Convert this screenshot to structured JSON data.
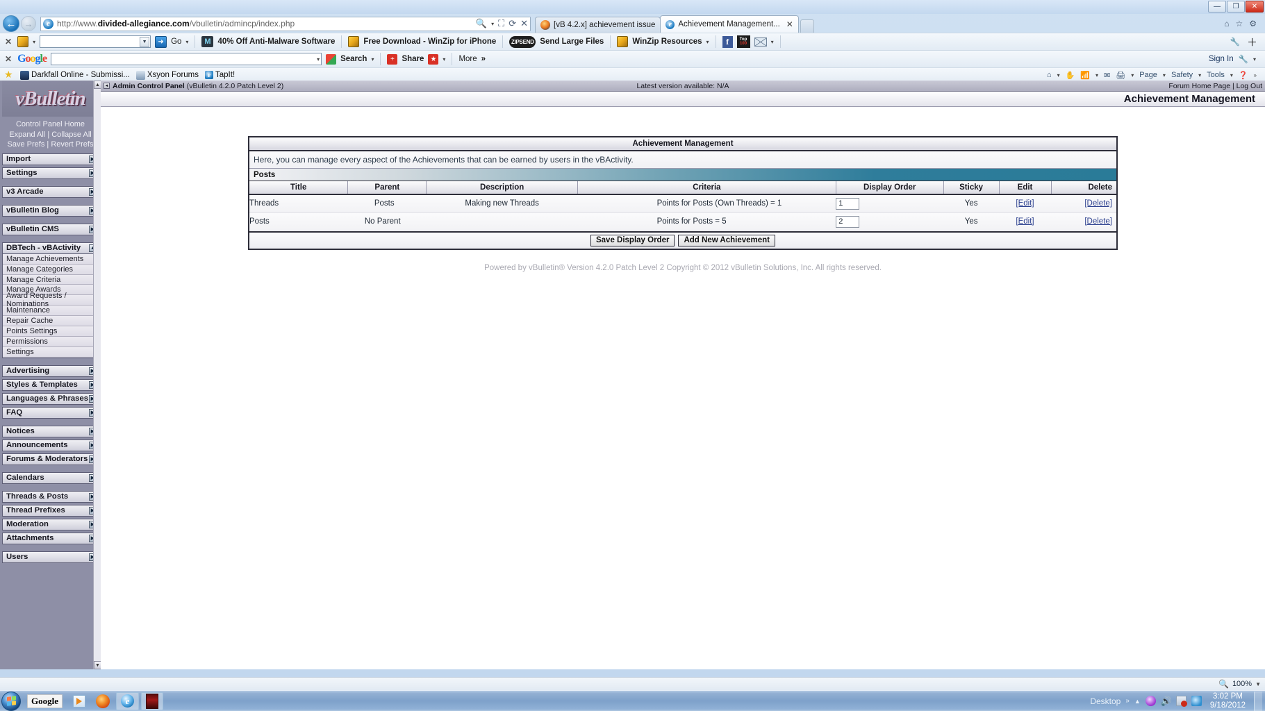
{
  "browser": {
    "window_buttons": {
      "minimize": "—",
      "maximize": "❐",
      "close": "✕"
    },
    "url_prefix": "http://www.",
    "url_domain": "divided-allegiance.com",
    "url_path": "/vbulletin/admincp/index.php",
    "tabs": [
      {
        "label": "[vB 4.2.x] achievement issue",
        "active": false
      },
      {
        "label": "Achievement Management...",
        "active": true,
        "close": "✕"
      }
    ],
    "winzip_toolbar": {
      "close_x": "✕",
      "go_label": "Go",
      "items": [
        "40% Off Anti-Malware Software",
        "Free Download - WinZip for iPhone",
        "Send Large Files",
        "WinZip Resources"
      ],
      "zipsend_label": "ZIPSEND",
      "top100_top": "Top",
      "top100_num": "100"
    },
    "google_toolbar": {
      "close_x": "✕",
      "logo": "Google",
      "search_label": "Search",
      "share_label": "Share",
      "more_label": "More",
      "more_chevron": "»",
      "signin_label": "Sign In"
    },
    "favorites": [
      "Darkfall Online - Submissi...",
      "Xsyon Forums",
      "TapIt!"
    ],
    "command_bar": [
      "Page",
      "Safety",
      "Tools"
    ],
    "status": {
      "zoom": "100%",
      "zoom_caret": "▼"
    }
  },
  "admin": {
    "top_bar": {
      "title": "Admin Control Panel",
      "version": "(vBulletin 4.2.0 Patch Level 2)",
      "latest_version": "Latest version available: N/A",
      "forum_home": "Forum Home Page",
      "separator": "|",
      "logout": "Log Out"
    },
    "page_title": "Achievement Management"
  },
  "sidebar": {
    "logo_text": "vBulletin",
    "cp_links": {
      "home": "Control Panel Home",
      "expand": "Expand All",
      "collapse": "Collapse All",
      "save_prefs": "Save Prefs",
      "revert_prefs": "Revert Prefs",
      "sep": "|"
    },
    "groups": [
      {
        "label": "Import",
        "expanded": false,
        "gap_after": false
      },
      {
        "label": "Settings",
        "expanded": false,
        "gap_after": true
      },
      {
        "label": "v3 Arcade",
        "expanded": false,
        "gap_after": true
      },
      {
        "label": "vBulletin Blog",
        "expanded": false,
        "gap_after": true
      },
      {
        "label": "vBulletin CMS",
        "expanded": false,
        "gap_after": true
      },
      {
        "label": "DBTech - vBActivity",
        "expanded": true,
        "gap_after": true,
        "items": [
          "Manage Achievements",
          "Manage Categories",
          "Manage Criteria",
          "Manage Awards",
          "Award Requests / Nominations",
          "Maintenance",
          "Repair Cache",
          "Points Settings",
          "Permissions",
          "Settings"
        ]
      },
      {
        "label": "Advertising",
        "expanded": false,
        "gap_after": false
      },
      {
        "label": "Styles & Templates",
        "expanded": false,
        "gap_after": false
      },
      {
        "label": "Languages & Phrases",
        "expanded": false,
        "gap_after": false
      },
      {
        "label": "FAQ",
        "expanded": false,
        "gap_after": true
      },
      {
        "label": "Notices",
        "expanded": false,
        "gap_after": false
      },
      {
        "label": "Announcements",
        "expanded": false,
        "gap_after": false
      },
      {
        "label": "Forums & Moderators",
        "expanded": false,
        "gap_after": true
      },
      {
        "label": "Calendars",
        "expanded": false,
        "gap_after": true
      },
      {
        "label": "Threads & Posts",
        "expanded": false,
        "gap_after": false
      },
      {
        "label": "Thread Prefixes",
        "expanded": false,
        "gap_after": false
      },
      {
        "label": "Moderation",
        "expanded": false,
        "gap_after": false
      },
      {
        "label": "Attachments",
        "expanded": false,
        "gap_after": true
      },
      {
        "label": "Users",
        "expanded": false,
        "gap_after": false
      }
    ],
    "arrow_collapsed": "▶",
    "arrow_expanded": "▲"
  },
  "panel": {
    "title": "Achievement Management",
    "description": "Here, you can manage every aspect of the Achievements that can be earned by users in the vBActivity.",
    "category_label": "Posts",
    "columns": [
      "Title",
      "Parent",
      "Description",
      "Criteria",
      "Display Order",
      "Sticky",
      "Edit",
      "Delete"
    ],
    "rows": [
      {
        "title": "Threads",
        "parent": "Posts",
        "parent_has_icon": true,
        "description": "Making new Threads",
        "criteria": "Points for Posts (Own Threads) = 1",
        "display_order": "1",
        "sticky": "Yes",
        "edit": "[Edit]",
        "delete": "[Delete]"
      },
      {
        "title": "Posts",
        "parent": "No Parent",
        "parent_has_icon": false,
        "description": "",
        "criteria": "Points for Posts = 5",
        "display_order": "2",
        "sticky": "Yes",
        "edit": "[Edit]",
        "delete": "[Delete]"
      }
    ],
    "buttons": {
      "save_display_order": "Save Display Order",
      "add_new_achievement": "Add New Achievement"
    },
    "footer": "Powered by vBulletin® Version 4.2.0 Patch Level 2 Copyright © 2012 vBulletin Solutions, Inc. All rights reserved."
  },
  "taskbar": {
    "google_label": "Google",
    "desktop_label": "Desktop",
    "desktop_chevron": "»",
    "tray_caret": "▲",
    "time": "3:02 PM",
    "date": "9/18/2012"
  }
}
